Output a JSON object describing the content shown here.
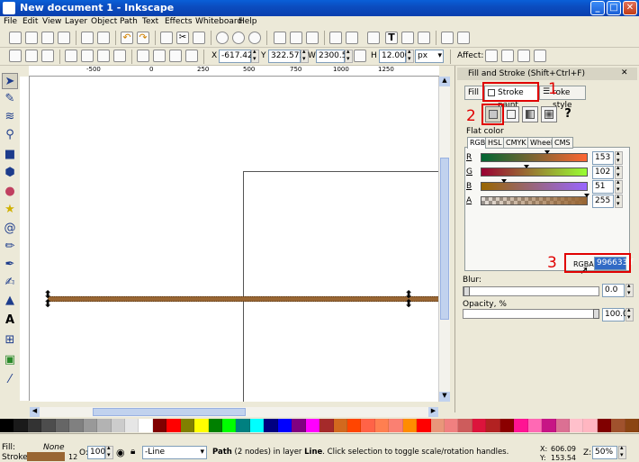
{
  "window": {
    "title": "New document 1 - Inkscape",
    "min": "_",
    "max": "□",
    "close": "✕"
  },
  "menu": [
    "File",
    "Edit",
    "View",
    "Layer",
    "Object",
    "Path",
    "Text",
    "Effects",
    "Whiteboard",
    "Help"
  ],
  "tool_controls": {
    "x_label": "X",
    "x_value": "-617.42",
    "y_label": "Y",
    "y_value": "322.571",
    "w_label": "W",
    "w_value": "2300.57",
    "h_label": "H",
    "h_value": "12.000",
    "unit": "px",
    "affect_label": "Affect:"
  },
  "ruler_labels": [
    "-500",
    "0",
    "250",
    "500",
    "750",
    "1000",
    "1250"
  ],
  "dialog": {
    "title": "Fill and Stroke (Shift+Ctrl+F)",
    "tab_fill": "Fill",
    "tab_stroke_paint": "Stroke paint",
    "tab_stroke_style": "roke style",
    "flat_color_label": "Flat color",
    "subtabs": [
      "RGB",
      "HSL",
      "CMYK",
      "Wheel",
      "CMS"
    ],
    "channels": [
      {
        "label": "R",
        "value": "153",
        "gradient": "linear-gradient(90deg,#006633,#ff6633)"
      },
      {
        "label": "G",
        "value": "102",
        "gradient": "linear-gradient(90deg,#990033,#99ff33)"
      },
      {
        "label": "B",
        "value": "51",
        "gradient": "linear-gradient(90deg,#996600,#9966ff)"
      },
      {
        "label": "A",
        "value": "255",
        "gradient": "linear-gradient(90deg,#eeeeee,#996633)"
      }
    ],
    "rgba_label": "RGBA:",
    "rgba_value": "996633ff",
    "blur_label": "Blur:",
    "blur_value": "0.0",
    "opacity_label": "Opacity, %",
    "opacity_value": "100.0",
    "question_mark": "?"
  },
  "annotations": [
    "1",
    "2",
    "3"
  ],
  "palette": [
    "#000000",
    "#1a1a1a",
    "#333333",
    "#4d4d4d",
    "#666666",
    "#808080",
    "#999999",
    "#b3b3b3",
    "#cccccc",
    "#e6e6e6",
    "#ffffff",
    "#800000",
    "#ff0000",
    "#808000",
    "#ffff00",
    "#008000",
    "#00ff00",
    "#008080",
    "#00ffff",
    "#000080",
    "#0000ff",
    "#800080",
    "#ff00ff",
    "#a52a2a",
    "#d2691e",
    "#ff4500",
    "#ff6347",
    "#ff7f50",
    "#fa8072",
    "#ff8c00",
    "#ff0000",
    "#e9967a",
    "#f08080",
    "#cd5c5c",
    "#dc143c",
    "#b22222",
    "#8b0000",
    "#ff1493",
    "#ff69b4",
    "#c71585",
    "#db7093",
    "#ffc0cb",
    "#ffb6c1",
    "#800000",
    "#a0522d",
    "#8b4513"
  ],
  "status": {
    "fill_label": "Fill:",
    "fill_value": "None",
    "stroke_label": "Stroke:",
    "stroke_width": "12",
    "stroke_color": "#996633",
    "opacity_label": "O:",
    "opacity_value": "100",
    "layer": "-Line",
    "message_bold": "Path",
    "message": " (2 nodes) in layer ",
    "layer_bold": "Line",
    "message_end": ". Click selection to toggle scale/rotation handles.",
    "x_label": "X:",
    "x": "606.09",
    "y_label": "Y:",
    "y": "153.54",
    "zoom_label": "Z:",
    "zoom": "50%"
  }
}
